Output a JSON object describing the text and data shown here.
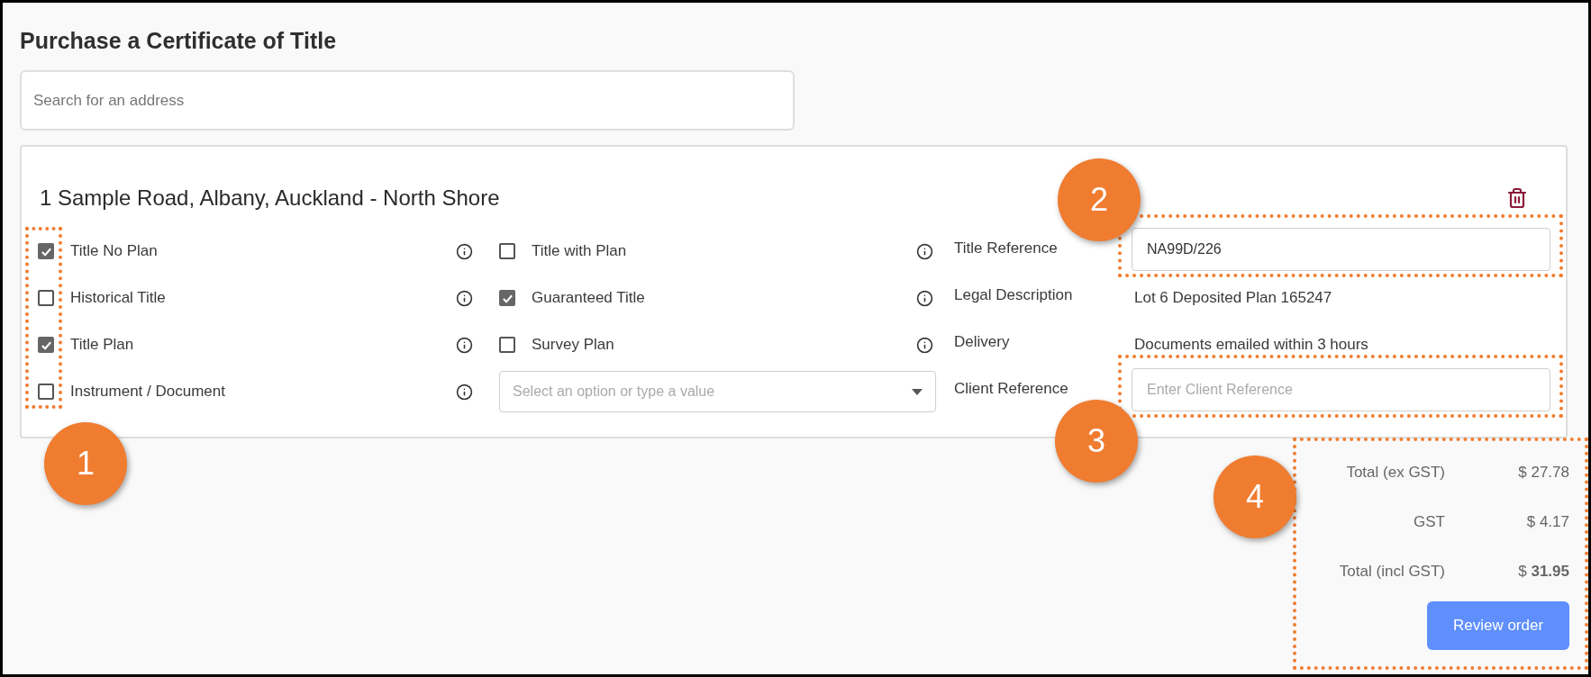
{
  "page_title": "Purchase a Certificate of Title",
  "search": {
    "placeholder": "Search for an address"
  },
  "address": "1 Sample Road, Albany, Auckland - North Shore",
  "options_column_1": [
    {
      "kind": "checkbox",
      "label": "Title No Plan",
      "checked": true
    },
    {
      "kind": "checkbox",
      "label": "Historical Title",
      "checked": false
    },
    {
      "kind": "checkbox",
      "label": "Title Plan",
      "checked": true
    },
    {
      "kind": "checkbox",
      "label": "Instrument / Document",
      "checked": false
    }
  ],
  "options_column_2": [
    {
      "kind": "checkbox",
      "label": "Title with Plan",
      "checked": false
    },
    {
      "kind": "checkbox",
      "label": "Guaranteed Title",
      "checked": true
    },
    {
      "kind": "checkbox",
      "label": "Survey Plan",
      "checked": false
    },
    {
      "kind": "select",
      "placeholder": "Select an option or type a value"
    }
  ],
  "details": [
    {
      "kind": "input",
      "label": "Title Reference",
      "value": "NA99D/226",
      "annotated": true
    },
    {
      "kind": "text",
      "label": "Legal Description",
      "value": "Lot 6 Deposited Plan 165247"
    },
    {
      "kind": "text",
      "label": "Delivery",
      "value": "Documents emailed within 3 hours"
    },
    {
      "kind": "input",
      "label": "Client Reference",
      "placeholder": "Enter Client Reference",
      "annotated": true
    }
  ],
  "totals": [
    {
      "label": "Total (ex GST)",
      "value": "$ 27.78"
    },
    {
      "label": "GST",
      "value": "$ 4.17"
    },
    {
      "label": "Total (incl GST)",
      "value": "$ **31.95**"
    }
  ],
  "review_button": "Review order",
  "callouts": [
    {
      "label": "1"
    },
    {
      "label": "2"
    },
    {
      "label": "3"
    },
    {
      "label": "4"
    }
  ]
}
